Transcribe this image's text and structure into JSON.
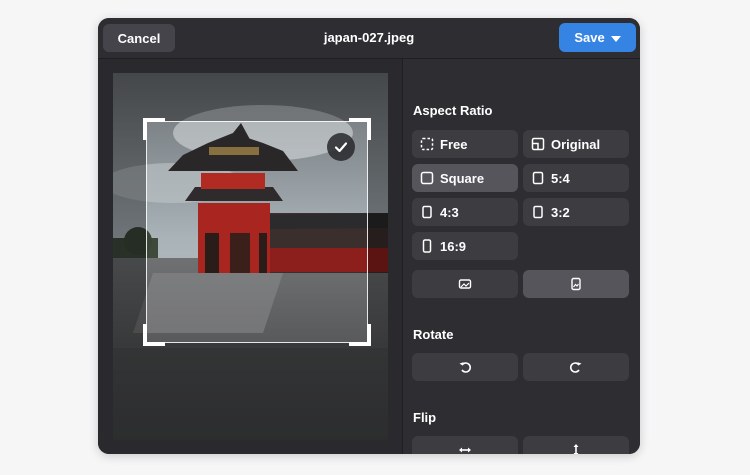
{
  "header": {
    "cancel_label": "Cancel",
    "title": "japan-027.jpeg",
    "save_label": "Save"
  },
  "sidebar": {
    "aspect_ratio_title": "Aspect Ratio",
    "aspect_options": [
      {
        "label": "Free",
        "icon": "dashed-square-icon",
        "selected": false
      },
      {
        "label": "Original",
        "icon": "image-original-icon",
        "selected": false
      },
      {
        "label": "Square",
        "icon": "square-icon",
        "selected": true
      },
      {
        "label": "5:4",
        "icon": "portrait-rect-icon",
        "selected": false
      },
      {
        "label": "4:3",
        "icon": "portrait-rect-icon",
        "selected": false
      },
      {
        "label": "3:2",
        "icon": "portrait-rect-icon",
        "selected": false
      },
      {
        "label": "16:9",
        "icon": "portrait-rect-icon",
        "selected": false
      }
    ],
    "orientation": {
      "landscape_icon": "landscape-orientation-icon",
      "portrait_icon": "portrait-orientation-icon",
      "selected": "portrait"
    },
    "rotate_title": "Rotate",
    "rotate": {
      "left_icon": "rotate-left-icon",
      "right_icon": "rotate-right-icon"
    },
    "flip_title": "Flip",
    "flip": {
      "horizontal_icon": "flip-horizontal-icon",
      "vertical_icon": "flip-vertical-icon"
    }
  },
  "colors": {
    "accent": "#3584e4",
    "window_bg": "#2a2a2e",
    "button_bg": "#3c3c41",
    "selected_bg": "#55555b"
  }
}
